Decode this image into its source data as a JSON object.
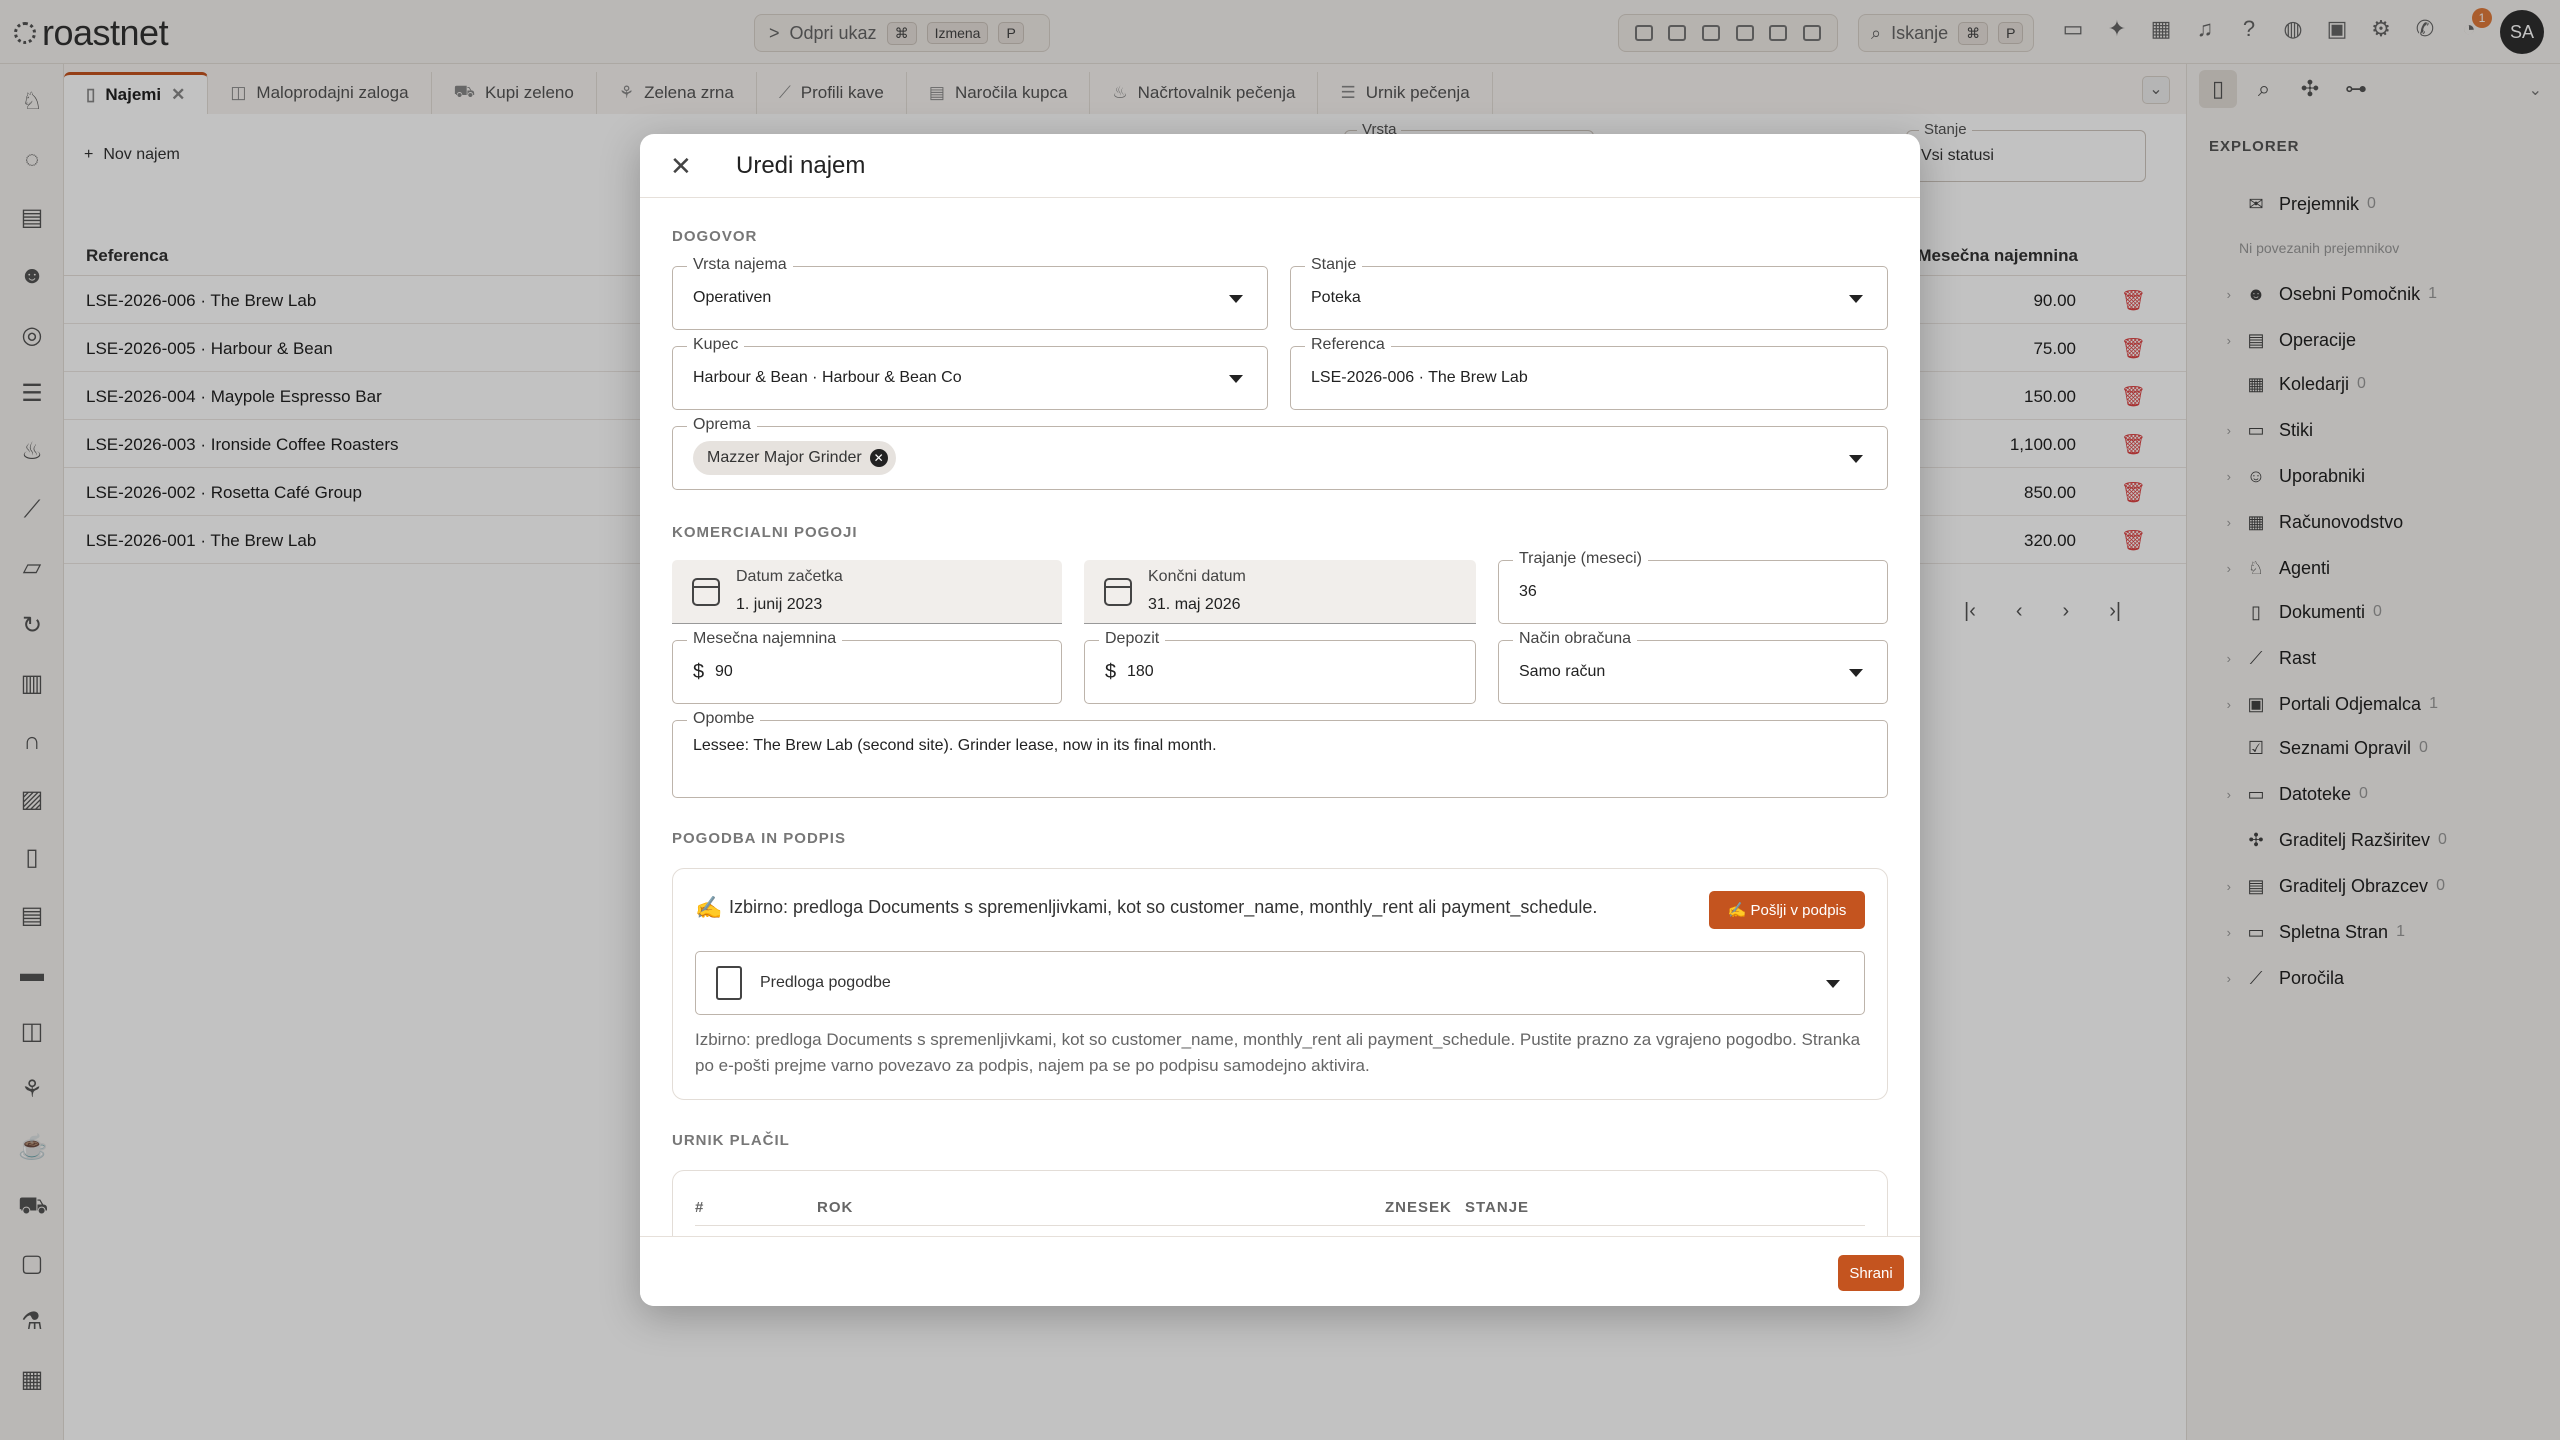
{
  "app": {
    "logo_text": "roastnet",
    "avatar": "SA",
    "notification_count": "1"
  },
  "command": {
    "label": "Odpri ukaz",
    "key1": "⌘",
    "key2": "Izmena",
    "key3": "P"
  },
  "search": {
    "label": "Iskanje",
    "key1": "⌘",
    "key2": "P"
  },
  "tabs": [
    {
      "label": "Najemi"
    },
    {
      "label": "Maloprodajni zaloga"
    },
    {
      "label": "Kupi zeleno"
    },
    {
      "label": "Zelena zrna"
    },
    {
      "label": "Profili kave"
    },
    {
      "label": "Naročila kupca"
    },
    {
      "label": "Načrtovalnik pečenja"
    },
    {
      "label": "Urnik pečenja"
    }
  ],
  "main": {
    "new_label": "Nov najem",
    "filter_type_label": "Vrsta",
    "filter_status_label": "Stanje",
    "filter_status_value": "Vsi statusi",
    "col_reference": "Referenca",
    "col_rent": "Mesečna najemnina",
    "rows": [
      {
        "ref": "LSE-2026-006 · The Brew Lab",
        "amount": "90.00"
      },
      {
        "ref": "LSE-2026-005 · Harbour & Bean",
        "amount": "75.00"
      },
      {
        "ref": "LSE-2026-004 · Maypole Espresso Bar",
        "amount": "150.00"
      },
      {
        "ref": "LSE-2026-003 · Ironside Coffee Roasters",
        "amount": "1,100.00"
      },
      {
        "ref": "LSE-2026-002 · Rosetta Café Group",
        "amount": "850.00"
      },
      {
        "ref": "LSE-2026-001 · The Brew Lab",
        "amount": "320.00"
      }
    ]
  },
  "explorer": {
    "title": "EXPLORER",
    "no_recipients": "Ni povezanih prejemnikov",
    "items": [
      {
        "label": "Prejemnik",
        "count": "0"
      },
      {
        "label": "Osebni Pomočnik",
        "count": "1"
      },
      {
        "label": "Operacije",
        "count": ""
      },
      {
        "label": "Koledarji",
        "count": "0"
      },
      {
        "label": "Stiki",
        "count": ""
      },
      {
        "label": "Uporabniki",
        "count": ""
      },
      {
        "label": "Računovodstvo",
        "count": ""
      },
      {
        "label": "Agenti",
        "count": ""
      },
      {
        "label": "Dokumenti",
        "count": "0"
      },
      {
        "label": "Rast",
        "count": ""
      },
      {
        "label": "Portali Odjemalca",
        "count": "1"
      },
      {
        "label": "Seznami Opravil",
        "count": "0"
      },
      {
        "label": "Datoteke",
        "count": "0"
      },
      {
        "label": "Graditelj Razširitev",
        "count": "0"
      },
      {
        "label": "Graditelj Obrazcev",
        "count": "0"
      },
      {
        "label": "Spletna Stran",
        "count": "1"
      },
      {
        "label": "Poročila",
        "count": ""
      }
    ]
  },
  "modal": {
    "title": "Uredi najem",
    "section_contract": "DOGOVOR",
    "lease_type_label": "Vrsta najema",
    "lease_type_value": "Operativen",
    "status_label": "Stanje",
    "status_value": "Poteka",
    "customer_label": "Kupec",
    "customer_value": "Harbour & Bean · Harbour & Bean Co",
    "reference_label": "Referenca",
    "reference_value": "LSE-2026-006 · The Brew Lab",
    "equipment_label": "Oprema",
    "equipment_chip": "Mazzer Major Grinder",
    "section_terms": "KOMERCIALNI POGOJI",
    "start_label": "Datum začetka",
    "start_value": "1. junij 2023",
    "end_label": "Končni datum",
    "end_value": "31. maj 2026",
    "duration_label": "Trajanje (meseci)",
    "duration_value": "36",
    "rent_label": "Mesečna najemnina",
    "rent_currency": "$",
    "rent_value": "90",
    "deposit_label": "Depozit",
    "deposit_currency": "$",
    "deposit_value": "180",
    "billing_label": "Način obračuna",
    "billing_value": "Samo račun",
    "notes_label": "Opombe",
    "notes_value": "Lessee: The Brew Lab (second site). Grinder lease, now in its final month.",
    "section_contract_sign": "POGODBA IN PODPIS",
    "sign_text": "Izbirno: predloga Documents s spremenljivkami, kot so customer_name, monthly_rent ali payment_schedule.",
    "sign_button": "Pošlji v podpis",
    "template_placeholder": "Predloga pogodbe",
    "template_help": "Izbirno: predloga Documents s spremenljivkami, kot so customer_name, monthly_rent ali payment_schedule. Pustite prazno za vgrajeno pogodbo. Stranka po e-pošti prejme varno povezavo za podpis, najem pa se po podpisu samodejno aktivira.",
    "section_schedule": "URNIK PLAČIL",
    "sched_col_num": "#",
    "sched_col_due": "ROK",
    "sched_col_amount": "ZNESEK",
    "sched_col_status": "STANJE",
    "save_button": "Shrani"
  }
}
